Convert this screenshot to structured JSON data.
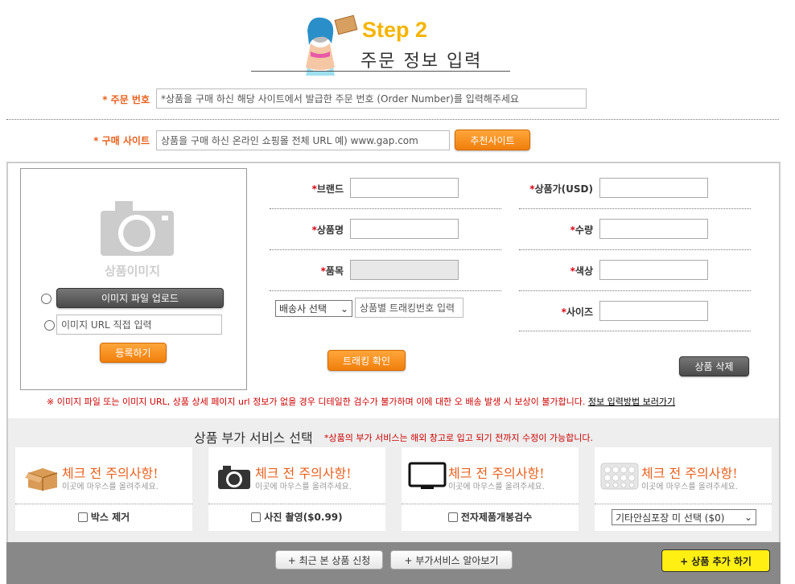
{
  "header": {
    "step": "Step 2",
    "subtitle": "주문 정보 입력"
  },
  "order": {
    "label": "* 주문 번호",
    "placeholder": "*상품을 구매 하신 해당 사이트에서 발급한 주문 번호 (Order Number)를 입력해주세요"
  },
  "site": {
    "label": "* 구매 사이트",
    "placeholder": "상품을 구매 하신 온라인 쇼핑몰 전체 URL  예) www.gap.com",
    "recommend_button": "추천사이트"
  },
  "image": {
    "placeholder_label": "상품이미지",
    "upload_button": "이미지 파일 업로드",
    "url_placeholder": "이미지 URL 직접 입력",
    "register_button": "등록하기"
  },
  "fields": {
    "brand": "*브랜드",
    "name": "*상품명",
    "category": "*품목",
    "price": "*상품가(USD)",
    "qty": "*수량",
    "color": "*색상",
    "size": "*사이즈"
  },
  "tracking": {
    "carrier_select": "배송사 선택",
    "tracking_placeholder": "상품별 트래킹번호 입력",
    "confirm_button": "트래킹 확인"
  },
  "delete_button": "상품 삭제",
  "notice": {
    "text": "※ 이미지 파일 또는 이미지 URL, 상품 상세 페이지 url 정보가 없을 경우 디테일한 검수가 불가하며 이에 대한 오 배송 발생 시 보상이 불가합니다.",
    "link": "정보 입력방법 보러가기"
  },
  "services": {
    "title": "상품 부가 서비스 선택",
    "note": "*상품의 부가 서비스는 해외 창고로 입고 되기 전까지 수정이 가능합니다.",
    "cards": [
      {
        "heading": "체크 전 주의사항!",
        "hint": "이곳에 마우스를 올려주세요.",
        "option": "박스 제거",
        "icon": "box-icon"
      },
      {
        "heading": "체크 전 주의사항!",
        "hint": "이곳에 마우스를 올려주세요.",
        "option": "사진 촬영($0.99)",
        "icon": "camera-icon"
      },
      {
        "heading": "체크 전 주의사항!",
        "hint": "이곳에 마우스를 올려주세요.",
        "option": "전자제품개봉검수",
        "icon": "monitor-icon"
      },
      {
        "heading": "체크 전 주의사항!",
        "hint": "이곳에 마우스를 올려주세요.",
        "option": "기타안심포장 미 선택 ($0)",
        "icon": "bubble-wrap-icon"
      }
    ]
  },
  "bottom": {
    "recent_button": "+ 최근 본 상품 신청",
    "service_info_button": "+ 부가서비스 알아보기",
    "add_button": "+ 상품 추가 하기"
  }
}
